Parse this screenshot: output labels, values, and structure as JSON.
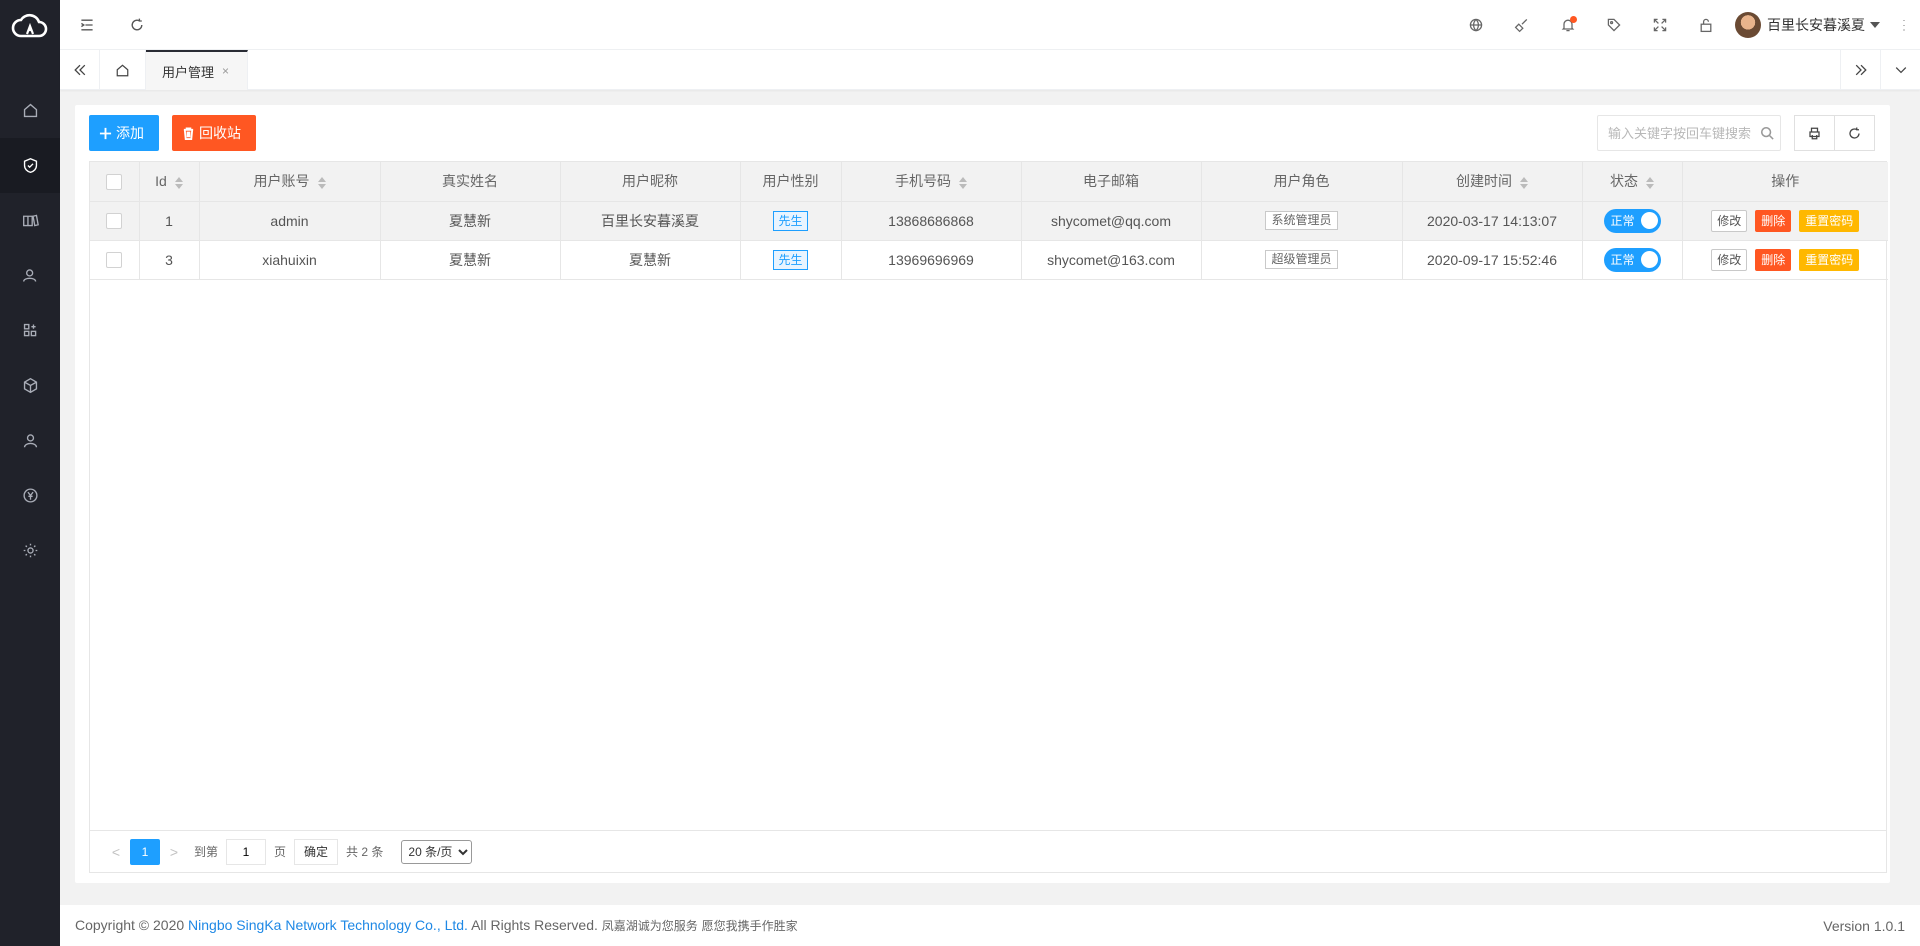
{
  "sidebar": {
    "logo": "cloud-logo",
    "items": [
      {
        "name": "home",
        "icon": "home-icon"
      },
      {
        "name": "security",
        "icon": "shield-check-icon",
        "active": true
      },
      {
        "name": "books",
        "icon": "books-icon"
      },
      {
        "name": "users",
        "icon": "user-group-icon"
      },
      {
        "name": "apps",
        "icon": "apps-icon"
      },
      {
        "name": "package",
        "icon": "cube-icon"
      },
      {
        "name": "member",
        "icon": "person-icon"
      },
      {
        "name": "finance",
        "icon": "yen-icon"
      },
      {
        "name": "settings",
        "icon": "gear-icon"
      }
    ]
  },
  "header": {
    "user_name": "百里长安暮溪夏",
    "icons": [
      "globe-icon",
      "broom-icon",
      "bell-icon",
      "tag-icon",
      "fullscreen-icon",
      "lock-icon"
    ]
  },
  "tabs": {
    "current": "用户管理",
    "close": "×"
  },
  "toolbar": {
    "add_label": "添加",
    "recycle_label": "回收站",
    "search_placeholder": "输入关键字按回车键搜索"
  },
  "table": {
    "headers": [
      "Id",
      "用户账号",
      "真实姓名",
      "用户昵称",
      "用户性别",
      "手机号码",
      "电子邮箱",
      "用户角色",
      "创建时间",
      "状态",
      "操作"
    ],
    "rows": [
      {
        "id": "1",
        "account": "admin",
        "real_name": "夏慧新",
        "nickname": "百里长安暮溪夏",
        "gender": "先生",
        "phone": "13868686868",
        "email": "shycomet@qq.com",
        "role": "系统管理员",
        "created": "2020-03-17 14:13:07",
        "status": "正常"
      },
      {
        "id": "3",
        "account": "xiahuixin",
        "real_name": "夏慧新",
        "nickname": "夏慧新",
        "gender": "先生",
        "phone": "13969696969",
        "email": "shycomet@163.com",
        "role": "超级管理员",
        "created": "2020-09-17 15:52:46",
        "status": "正常"
      }
    ],
    "actions": {
      "edit": "修改",
      "delete": "删除",
      "reset": "重置密码"
    }
  },
  "pager": {
    "prev": "<",
    "current": "1",
    "next": ">",
    "goto_label": "到第",
    "goto_value": "1",
    "page_unit": "页",
    "confirm": "确定",
    "total": "共 2 条",
    "page_size": "20 条/页"
  },
  "footer": {
    "copyright_prefix": "Copyright © 2020 ",
    "company": "Ningbo SingKa Network Technology Co., Ltd.",
    "rights": " All Rights Reserved. ",
    "slogan": "凤嘉湖诚为您服务 愿您我携手作胜家",
    "version": "Version 1.0.1"
  },
  "colors": {
    "sidebar_bg": "#20222a",
    "primary": "#1e9fff",
    "danger": "#ff5722",
    "warning": "#ffb800",
    "link": "#1e88e5"
  }
}
